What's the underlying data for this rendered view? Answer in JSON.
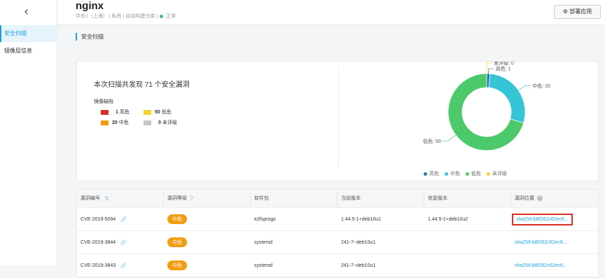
{
  "sidebar": {
    "back_icon": "chevron-left-icon",
    "items": [
      {
        "label": "安全扫描",
        "active": true
      },
      {
        "label": "镜像层信息",
        "active": false
      }
    ]
  },
  "header": {
    "title": "nginx",
    "subtitle_region": "华东2（上海）",
    "subtitle_visibility": "私有",
    "subtitle_repo_type": "自动构建仓库",
    "subtitle_status": "正常",
    "deploy_button": "部署应用",
    "deploy_icon": "gear-icon"
  },
  "section_title": "安全扫描",
  "summary": {
    "text": "本次扫描共发现 71 个安全漏洞",
    "defect_label": "镜像缺陷",
    "legend": [
      {
        "count": "1",
        "label": "高危",
        "color": "#d93025"
      },
      {
        "count": "50",
        "label": "低危",
        "color": "#f5d327"
      },
      {
        "count": "20",
        "label": "中危",
        "color": "#f39c12"
      },
      {
        "count": "0",
        "label": "未评级",
        "color": "#c8c8c8"
      }
    ]
  },
  "chart_data": {
    "type": "pie",
    "donut": true,
    "slices": [
      {
        "label": "未评级",
        "value": 0,
        "color": "#f5d327",
        "display": "未评级: 0"
      },
      {
        "label": "高危",
        "value": 1,
        "color": "#1f78b4",
        "display": "高危: 1"
      },
      {
        "label": "中危",
        "value": 20,
        "color": "#36c5d6",
        "display": "中危: 20"
      },
      {
        "label": "低危",
        "value": 50,
        "color": "#4cc96a",
        "display": "低危: 50"
      }
    ],
    "legend": [
      {
        "label": "高危",
        "color": "#1f78b4"
      },
      {
        "label": "中危",
        "color": "#36c5d6"
      },
      {
        "label": "低危",
        "color": "#4cc96a"
      },
      {
        "label": "未评级",
        "color": "#f5d327"
      }
    ],
    "legend_position": "bottom"
  },
  "table": {
    "headers": [
      "漏洞编号",
      "漏洞等级",
      "软件包",
      "当前版本",
      "修复版本",
      "漏洞位置"
    ],
    "rows": [
      {
        "cve": "CVE-2019-5094",
        "level": "中危",
        "package": "e2fsprogs",
        "current": "1.44.5-1+deb10u1",
        "fixed": "1.44.5-1+deb10u2",
        "location": "sha256:b8f262c62ec6..."
      },
      {
        "cve": "CVE-2019-3844",
        "level": "中危",
        "package": "systemd",
        "current": "241-7~deb10u1",
        "fixed": "",
        "location": "sha256:b8f262c62ec6..."
      },
      {
        "cve": "CVE-2019-3843",
        "level": "中危",
        "package": "systemd",
        "current": "241-7~deb10u1",
        "fixed": "",
        "location": "sha256:b8f262c62ec6..."
      }
    ]
  }
}
